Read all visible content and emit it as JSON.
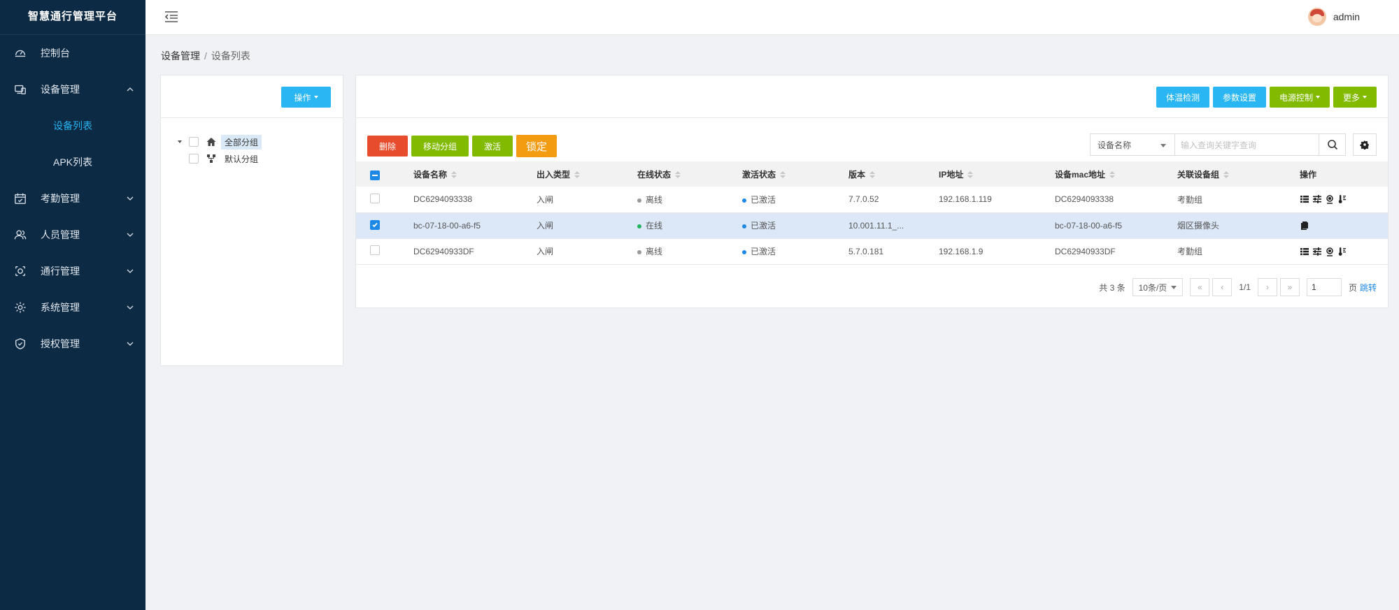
{
  "sidebar": {
    "brand": "智慧通行管理平台",
    "items": [
      {
        "label": "控制台",
        "icon": "dashboard-icon"
      },
      {
        "label": "设备管理",
        "icon": "devices-icon",
        "expanded": true,
        "children": [
          {
            "label": "设备列表",
            "active": true
          },
          {
            "label": "APK列表"
          }
        ]
      },
      {
        "label": "考勤管理",
        "icon": "calendar-icon"
      },
      {
        "label": "人员管理",
        "icon": "users-icon"
      },
      {
        "label": "通行管理",
        "icon": "camera-icon"
      },
      {
        "label": "系统管理",
        "icon": "gear-icon"
      },
      {
        "label": "授权管理",
        "icon": "shield-icon"
      }
    ]
  },
  "header": {
    "username": "admin"
  },
  "breadcrumb": {
    "parent": "设备管理",
    "separator": "/",
    "current": "设备列表"
  },
  "left_panel": {
    "op_button": "操作",
    "tree": {
      "root": "全部分组",
      "child": "默认分组"
    }
  },
  "main": {
    "top_actions": [
      "体温检测",
      "参数设置",
      "电源控制",
      "更多"
    ],
    "toolbar": {
      "delete": "删除",
      "move_group": "移动分组",
      "activate": "激活",
      "lock": "锁定"
    },
    "search": {
      "field": "设备名称",
      "placeholder": "输入查询关键字查询"
    },
    "columns": [
      "设备名称",
      "出入类型",
      "在线状态",
      "激活状态",
      "版本",
      "IP地址",
      "设备mac地址",
      "关联设备组",
      "操作"
    ],
    "rows": [
      {
        "name": "DC6294093338",
        "type": "入闸",
        "online": "离线",
        "online_color": "#999999",
        "active": "已激活",
        "version": "7.7.0.52",
        "ip": "192.168.1.119",
        "mac": "DC6294093338",
        "group": "考勤组",
        "checked": false,
        "ops": "full"
      },
      {
        "name": "bc-07-18-00-a6-f5",
        "type": "入闸",
        "online": "在线",
        "online_color": "#22b35e",
        "active": "已激活",
        "version": "10.001.11.1_...",
        "ip": "",
        "mac": "bc-07-18-00-a6-f5",
        "group": "烟区摄像头",
        "checked": true,
        "ops": "single"
      },
      {
        "name": "DC62940933DF",
        "type": "入闸",
        "online": "离线",
        "online_color": "#999999",
        "active": "已激活",
        "version": "5.7.0.181",
        "ip": "192.168.1.9",
        "mac": "DC62940933DF",
        "group": "考勤组",
        "checked": false,
        "ops": "full"
      }
    ],
    "pager": {
      "total": "共 3 条",
      "page_size": "10条/页",
      "page_info": "1/1",
      "page_input": "1",
      "page_unit": "页",
      "jump": "跳转",
      "first": "«",
      "prev": "‹",
      "next": "›",
      "last": "»"
    }
  },
  "colors": {
    "sidebar_bg": "#0c2a44",
    "accent_blue": "#29b6f2",
    "accent_green": "#82ba00",
    "danger": "#e74c2c",
    "warning": "#f39c12",
    "active_dot": "#1e88e5"
  }
}
